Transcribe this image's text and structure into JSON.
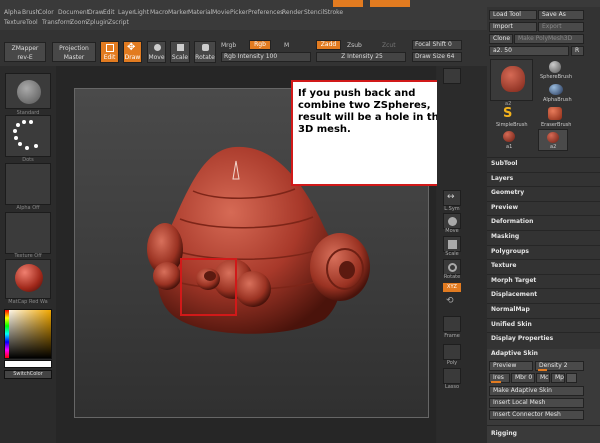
{
  "menu": {
    "row1": [
      "Alpha",
      "Brush",
      "Color",
      "Document",
      "Draw",
      "Edit",
      "Layer",
      "Light",
      "Macro",
      "Marker",
      "Material",
      "Movie",
      "Picker",
      "Preferences",
      "Render",
      "Stencil",
      "Stroke"
    ],
    "row2": [
      "Texture",
      "Tool",
      "Transform",
      "Zoom",
      "Zplugin",
      "Zscript"
    ]
  },
  "toolbar": {
    "zmapper": "ZMapper",
    "zmapper_sub": "rev-E",
    "projection": "Projection",
    "projection_sub": "Master",
    "edit": "Edit",
    "draw": "Draw",
    "move": "Move",
    "scale": "Scale",
    "rotate": "Rotate",
    "mrgb": "Mrgb",
    "rgb": "Rgb",
    "m": "M",
    "rgb_intensity": "Rgb Intensity 100",
    "zadd": "Zadd",
    "zsub": "Zsub",
    "zcut": "Zcut",
    "z_intensity": "Z Intensity 25",
    "focal_shift": "Focal Shift 0",
    "draw_size": "Draw Size 64"
  },
  "left_shelf": {
    "brush_label": "Standard",
    "stroke_label": "Dots",
    "alpha_label": "Alpha Off",
    "texture_label": "Texture Off",
    "material_label": "MatCap Red Wa",
    "switch_color": "SwitchColor"
  },
  "right_shelf": {
    "lsym": "L.Sym",
    "move": "Move",
    "scale": "Scale",
    "rotate": "Rotate",
    "xyz": "XYZ",
    "frame": "Frame",
    "poly": "Poly",
    "lasso": "Lasso"
  },
  "tool_panel": {
    "load_tool": "Load Tool",
    "save_as": "Save As",
    "import": "Import",
    "export": "Export",
    "clone": "Clone",
    "make_polymesh": "Make PolyMesh3D",
    "size_value": "a2. 50",
    "r": "R",
    "tools": [
      {
        "label": "a2"
      },
      {
        "label": "SphereBrush"
      },
      {
        "label": "AlphaBrush"
      },
      {
        "label": "SimpleBrush"
      },
      {
        "label": "EraserBrush"
      },
      {
        "label": "a1"
      },
      {
        "label": "a2"
      }
    ],
    "menus": [
      "SubTool",
      "Layers",
      "Geometry",
      "Preview",
      "Deformation",
      "Masking",
      "Polygroups",
      "Texture",
      "Morph Target",
      "Displacement",
      "NormalMap",
      "Unified Skin",
      "Display Properties"
    ],
    "adaptive_skin": "Adaptive Skin",
    "preview": "Preview",
    "density": "Density 2",
    "ires": "Ires",
    "mbr": "Mbr 0",
    "mc": "Mc",
    "mp": "Mp",
    "make_adaptive": "Make Adaptive Skin",
    "insert_local": "Insert Local Mesh",
    "insert_connector": "Insert Connector Mesh",
    "rigging": "Rigging"
  },
  "callout": {
    "text": "If you push back and combine two ZSpheres, result will be a hole in the 3D mesh."
  },
  "colors": {
    "accent": "#e27b20",
    "annotation_red": "#d11919",
    "mesh": "#b2422e"
  }
}
